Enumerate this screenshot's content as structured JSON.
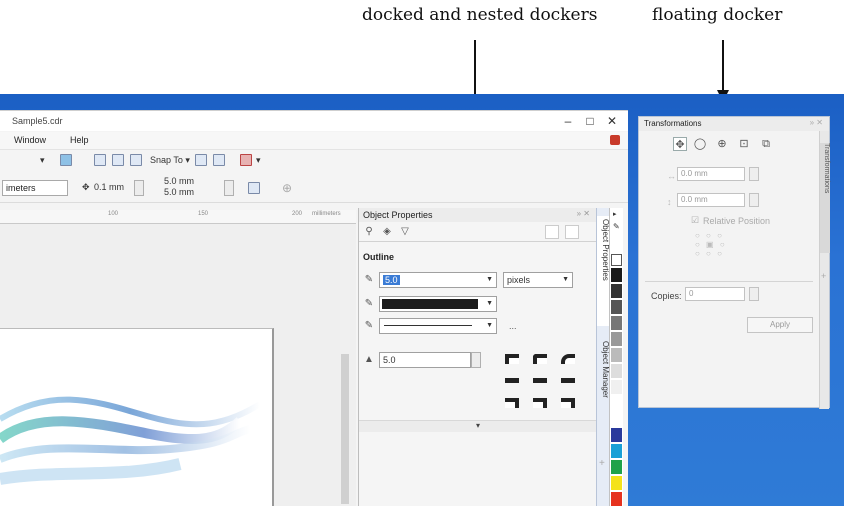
{
  "annotations": {
    "left": "docked and nested dockers",
    "right": "floating docker"
  },
  "window": {
    "title": "Sample5.cdr",
    "minimize": "–",
    "maximize": "□",
    "close": "✕"
  },
  "menu": {
    "items": [
      "Window",
      "Help"
    ]
  },
  "toolbar": {
    "snap_to": "Snap To ▾",
    "units": "imeters",
    "nudge": "0.1 mm",
    "dup_x": "5.0 mm",
    "dup_y": "5.0 mm"
  },
  "ruler": {
    "ticks": [
      "100",
      "150",
      "200"
    ],
    "units": "millimeters"
  },
  "object_properties": {
    "title": "Object Properties",
    "section": "Outline",
    "width_value": "5.0",
    "width_units": "pixels",
    "dash_preview": "...",
    "miter_value": "5.0",
    "expand": "▾"
  },
  "tabs": {
    "object_properties": "Object Properties",
    "object_manager": "Object Manager"
  },
  "palette": {
    "colors": [
      "#ffffff",
      "#1a1a1a",
      "#333333",
      "#555555",
      "#777777",
      "#999999",
      "#bbbbbb",
      "#dddddd",
      "#ffffff",
      "#2a3a9c",
      "#19a0d6",
      "#1fa24a",
      "#f4e21a",
      "#e6321e"
    ]
  },
  "transformations": {
    "title": "Transformations",
    "x_value": "0.0 mm",
    "y_value": "0.0 mm",
    "relative_position": "Relative Position",
    "copies_label": "Copies:",
    "copies_value": "0",
    "apply": "Apply",
    "side_tab": "Transformations"
  }
}
